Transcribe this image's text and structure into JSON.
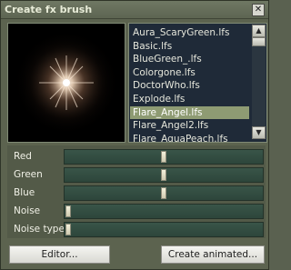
{
  "window": {
    "title": "Create fx brush",
    "close_symbol": "✕"
  },
  "brush_list": {
    "items": [
      "Aura_ScaryGreen.lfs",
      "Basic.lfs",
      "BlueGreen_.lfs",
      "Colorgone.lfs",
      "DoctorWho.lfs",
      "Explode.lfs",
      "Flare_Angel.lfs",
      "Flare_Angel2.lfs",
      "Flare_AquaPeach.lfs"
    ],
    "selected_index": 6
  },
  "sliders": [
    {
      "label": "Red",
      "value": 0.5
    },
    {
      "label": "Green",
      "value": 0.5
    },
    {
      "label": "Blue",
      "value": 0.5
    },
    {
      "label": "Noise",
      "value": 0.0
    },
    {
      "label": "Noise type",
      "value": 0.0
    }
  ],
  "buttons": {
    "editor": "Editor...",
    "create_animated": "Create animated..."
  },
  "colors": {
    "panel": "#5c634f",
    "list_background": "#1f2a38",
    "selection": "#8e9b73",
    "slider_track": "#395548"
  }
}
